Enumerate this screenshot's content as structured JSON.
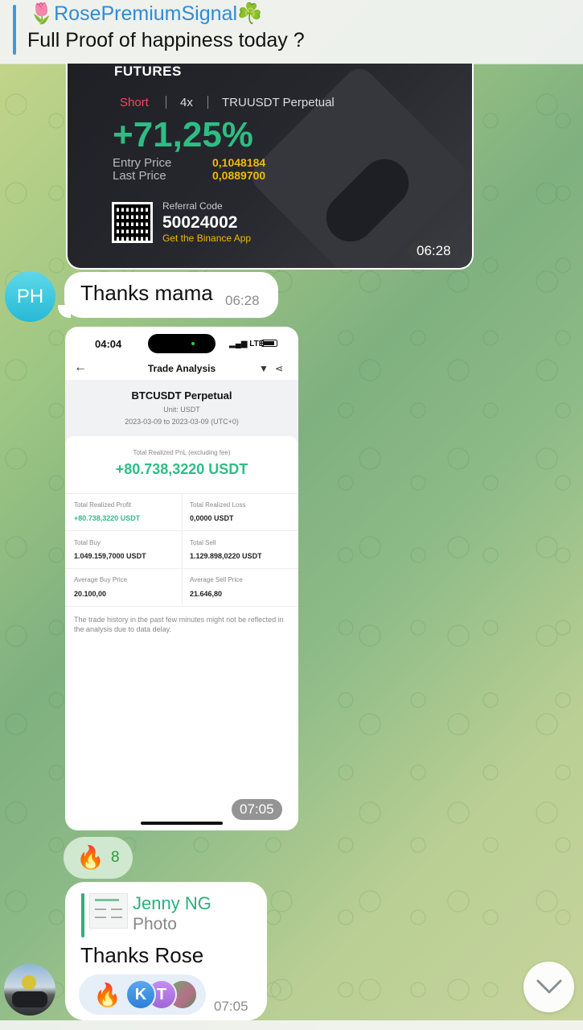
{
  "pinned": {
    "title": "🌷RosePremiumSignal☘️",
    "text": "Full Proof of happiness today ?"
  },
  "futures_card": {
    "label": "FUTURES",
    "side": "Short",
    "leverage": "4x",
    "pair": "TRUUSDT Perpetual",
    "pnl": "+71,25%",
    "entry_label": "Entry Price",
    "entry_value": "0,1048184",
    "last_label": "Last Price",
    "last_value": "0,0889700",
    "referral_label": "Referral Code",
    "referral_code": "50024002",
    "app_text": "Get the Binance App",
    "time": "06:28"
  },
  "message_thanks": {
    "avatar_initials": "PH",
    "text": "Thanks mama",
    "time": "06:28"
  },
  "trade_analysis": {
    "status_time": "04:04",
    "network": "LTE",
    "back_icon": "arrow-left-icon",
    "title": "Trade Analysis",
    "pair": "BTCUSDT Perpetual",
    "unit": "Unit: USDT",
    "range": "2023-03-09 to 2023-03-09 (UTC+0)",
    "total_label": "Total Realized PnL (excluding fee)",
    "total_value": "+80.738,3220 USDT",
    "cells": [
      {
        "label": "Total Realized Profit",
        "value": "+80.738,3220 USDT"
      },
      {
        "label": "Total Realized Loss",
        "value": "0,0000 USDT"
      },
      {
        "label": "Total Buy",
        "value": "1.049.159,7000 USDT"
      },
      {
        "label": "Total Sell",
        "value": "1.129.898,0220 USDT"
      },
      {
        "label": "Average Buy Price",
        "value": "20.100,00"
      },
      {
        "label": "Average Sell Price",
        "value": "21.646,80"
      }
    ],
    "note": "The trade history in the past few minutes might not be reflected in the analysis due to data delay.",
    "time": "07:05"
  },
  "reaction_fire": {
    "emoji": "🔥",
    "count": "8"
  },
  "reply_message": {
    "reply_name": "Jenny NG",
    "reply_type": "Photo",
    "text": "Thanks Rose",
    "reaction_emoji": "🔥",
    "reactor_k": "K",
    "reactor_t": "T",
    "time": "07:05"
  },
  "colors": {
    "accent_blue": "#2f8bd8",
    "green": "#2ebd85",
    "short_red": "#f6465d",
    "binance_yellow": "#f0b90b"
  }
}
